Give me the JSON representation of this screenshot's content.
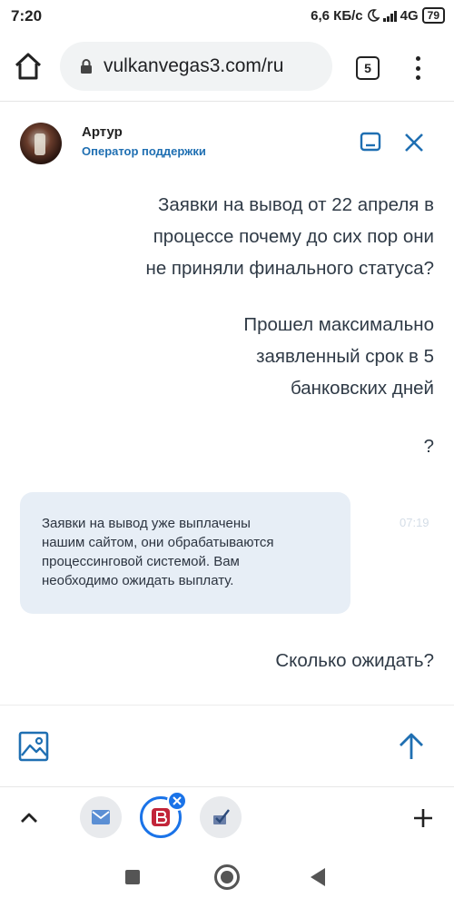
{
  "status_bar": {
    "time": "7:20",
    "net_speed": "6,6 КБ/с",
    "network": "4G",
    "battery": "79"
  },
  "browser": {
    "url": "vulkanvegas3.com/ru",
    "tab_count": "5"
  },
  "chat": {
    "agent_name": "Артур",
    "agent_role": "Оператор поддержки",
    "messages": [
      {
        "from": "user",
        "lines": [
          "Заявки на вывод от 22 апреля в",
          "процессе почему до сих пор они",
          "не приняли финального статуса?"
        ]
      },
      {
        "from": "user",
        "lines": [
          "Прошел максимально",
          "заявленный срок в 5",
          "банковских дней"
        ]
      },
      {
        "from": "user",
        "lines": [
          "?"
        ]
      },
      {
        "from": "operator",
        "lines": [
          "Заявки на вывод уже выплачены",
          "нашим сайтом, они обрабатываются",
          "процессинговой системой. Вам",
          "необходимо ожидать выплату."
        ],
        "time": "07:19"
      },
      {
        "from": "user",
        "lines": [
          "Сколько ожидать?"
        ]
      }
    ]
  },
  "colors": {
    "accent": "#1f6fb2",
    "operator_bubble": "#e7eef6",
    "tray_active": "#1a73e8"
  },
  "icons": {
    "home": "home-icon",
    "lock": "lock-icon",
    "minimize": "minimize-icon",
    "close": "close-icon",
    "image": "image-icon",
    "send": "send-arrow-icon"
  }
}
